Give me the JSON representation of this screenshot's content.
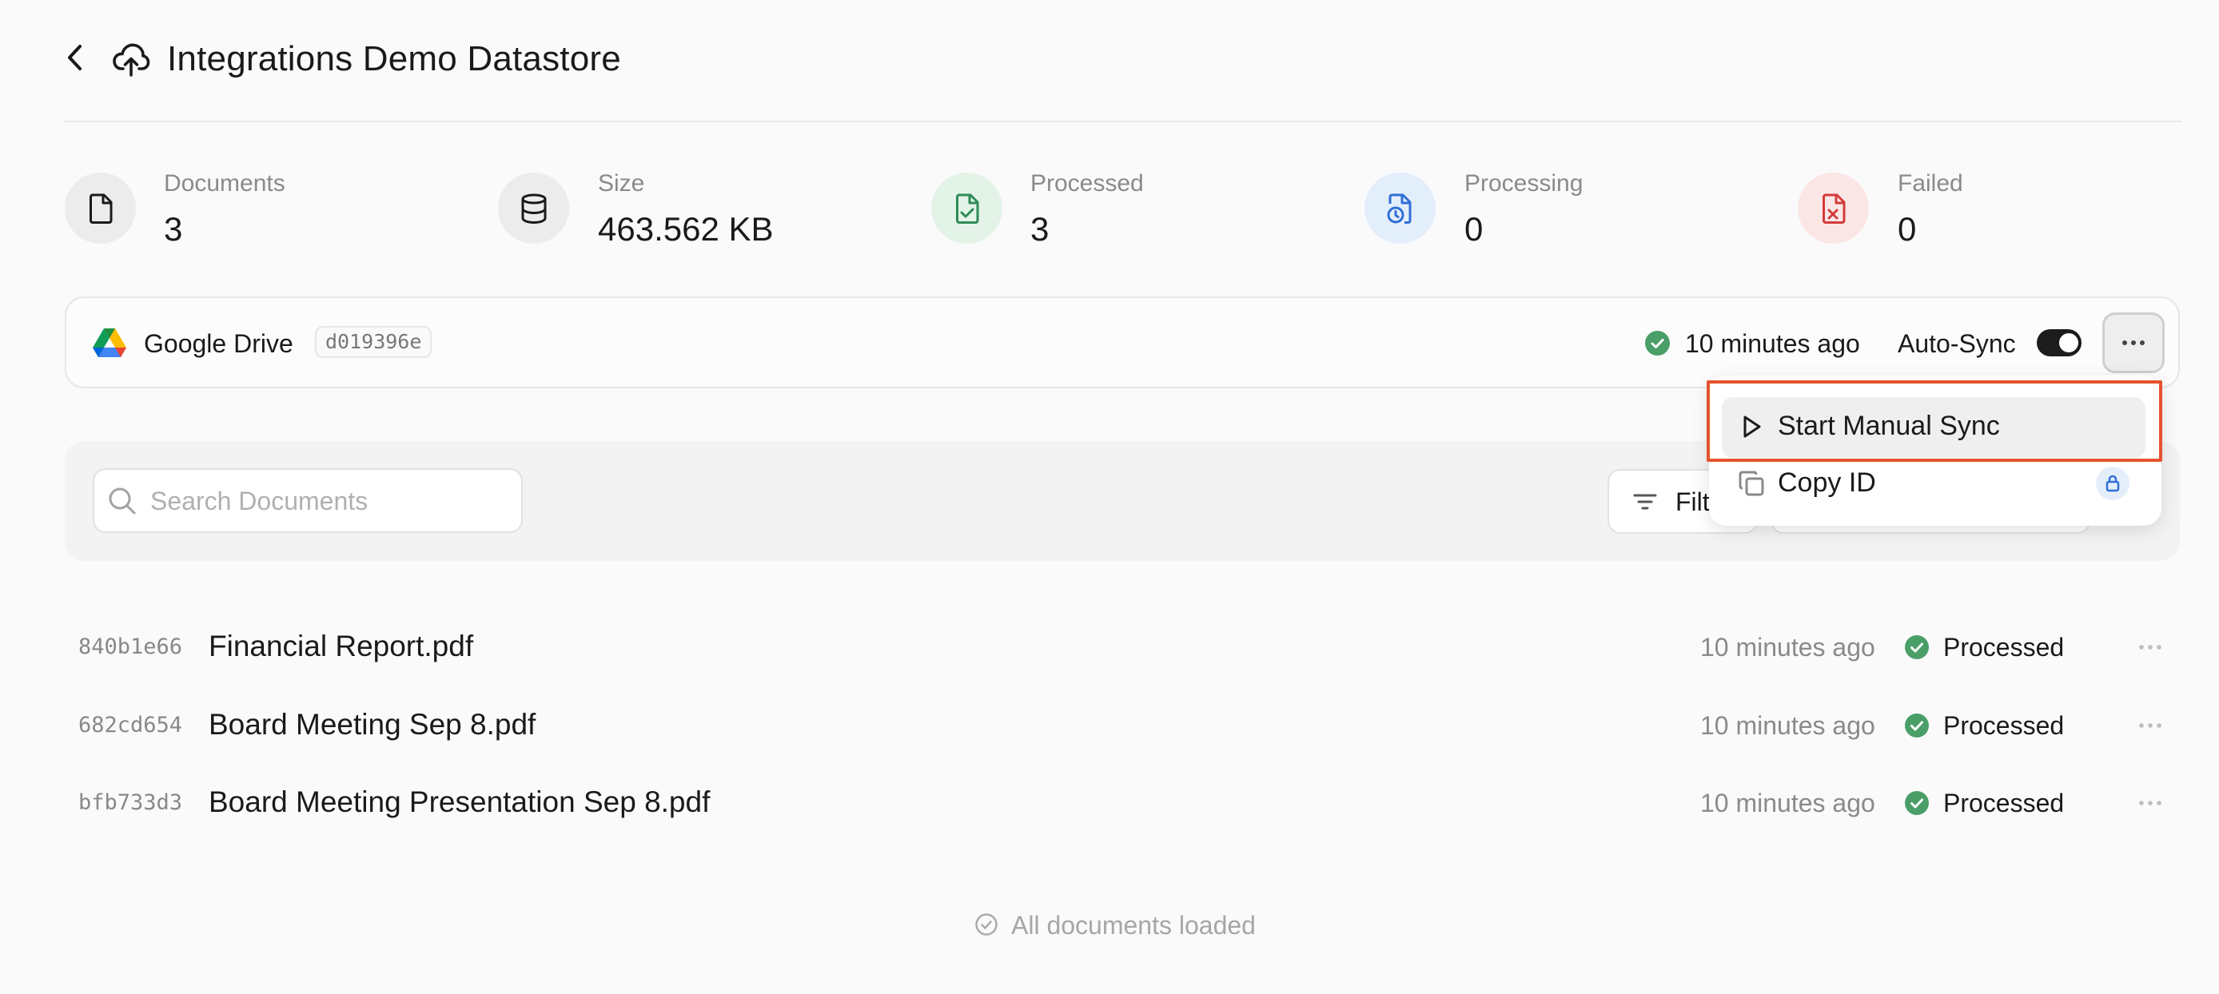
{
  "header": {
    "title": "Integrations Demo Datastore",
    "back_icon": "chevron-left-icon",
    "title_icon": "cloud-upload-icon"
  },
  "stats": {
    "documents": {
      "label": "Documents",
      "value": "3",
      "icon": "file-icon"
    },
    "size": {
      "label": "Size",
      "value": "463.562 KB",
      "icon": "database-icon"
    },
    "processed": {
      "label": "Processed",
      "value": "3",
      "icon": "file-check-icon",
      "color": "#2e8b57"
    },
    "processing": {
      "label": "Processing",
      "value": "0",
      "icon": "file-clock-icon",
      "color": "#2f6fd6"
    },
    "failed": {
      "label": "Failed",
      "value": "0",
      "icon": "file-x-icon",
      "color": "#d23b3b"
    }
  },
  "connector": {
    "name": "Google Drive",
    "id": "d019396e",
    "last_sync": "10 minutes ago",
    "autosync_label": "Auto-Sync",
    "autosync_on": true
  },
  "dropdown": {
    "items": [
      {
        "label": "Start Manual Sync",
        "icon": "play-icon"
      },
      {
        "label": "Copy ID",
        "icon": "copy-icon",
        "badge_icon": "lock-icon"
      }
    ],
    "highlight_color": "#e5532d"
  },
  "toolbar": {
    "search_placeholder": "Search Documents",
    "filter_label": "Filter"
  },
  "documents": [
    {
      "id": "840b1e66",
      "name": "Financial Report.pdf",
      "time": "10 minutes ago",
      "status": "Processed"
    },
    {
      "id": "682cd654",
      "name": "Board Meeting Sep 8.pdf",
      "time": "10 minutes ago",
      "status": "Processed"
    },
    {
      "id": "bfb733d3",
      "name": "Board Meeting Presentation Sep 8.pdf",
      "time": "10 minutes ago",
      "status": "Processed"
    }
  ],
  "footer": {
    "text": "All documents loaded"
  },
  "colors": {
    "success": "#4a9e68",
    "accent_dark": "#1c1c1c"
  }
}
